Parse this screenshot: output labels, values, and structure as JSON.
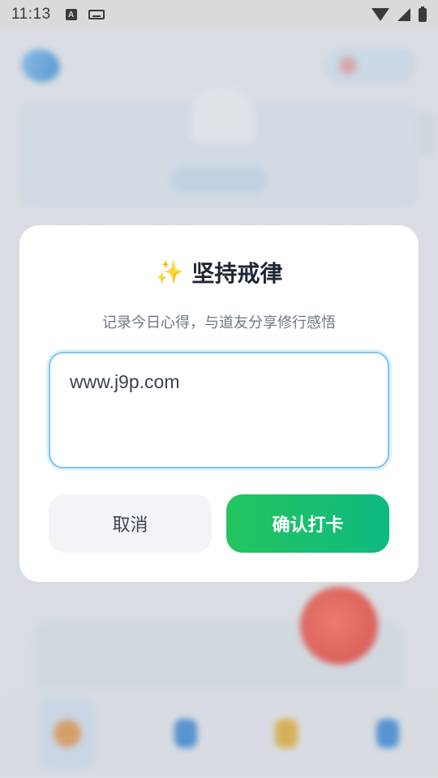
{
  "status_bar": {
    "time": "11:13",
    "icons": [
      "a-notification-icon",
      "keyboard-icon",
      "wifi-icon",
      "signal-icon",
      "battery-icon"
    ],
    "a_glyph": "A"
  },
  "dialog": {
    "icon": "sparkles-icon",
    "icon_glyph": "✨",
    "title": "坚持戒律",
    "subtitle": "记录今日心得，与道友分享修行感悟",
    "input_value": "www.j9p.com",
    "cancel_label": "取消",
    "confirm_label": "确认打卡"
  },
  "colors": {
    "confirm_start": "#22c55e",
    "confirm_end": "#10b981",
    "input_border": "#7cc6ef",
    "title": "#1f2633"
  }
}
